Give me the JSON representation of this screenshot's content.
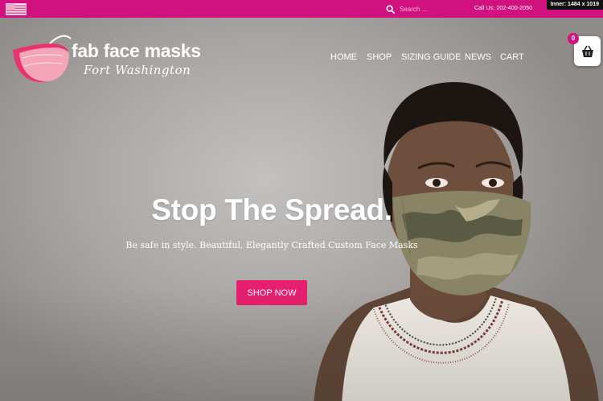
{
  "topbar": {
    "search_placeholder": "Search ...",
    "call_text": "Call Us: 202-400-2050",
    "inner_badge": "Inner: 1484 x 1019"
  },
  "logo": {
    "title": "fab face masks",
    "subtitle": "Fort Washington"
  },
  "nav": {
    "items": [
      {
        "label": "HOME"
      },
      {
        "label": "SHOP"
      },
      {
        "label": "SIZING GUIDE"
      },
      {
        "label": "NEWS"
      },
      {
        "label": "CART"
      }
    ]
  },
  "cart": {
    "count": "0"
  },
  "hero": {
    "headline": "Stop The Spread.",
    "tagline": "Be safe in style. Beautiful, Elegantly Crafted Custom Face Masks",
    "button_label": "SHOP NOW"
  },
  "colors": {
    "brand_pink": "#d1117e",
    "button_pink": "#e61f6e"
  },
  "icons": [
    "us-flag-icon",
    "search-icon",
    "basket-icon",
    "mask-logo-icon"
  ]
}
